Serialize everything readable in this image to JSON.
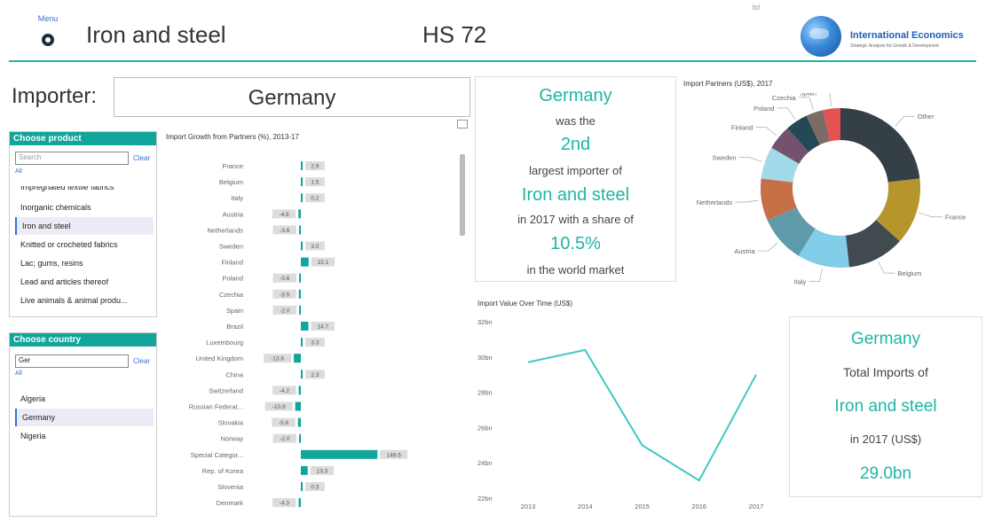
{
  "header": {
    "menu_label": "Menu",
    "title": "Iron and steel",
    "hs_code": "HS 72",
    "tiny_mark": "tcl",
    "logo_title": "International Economics",
    "logo_subtitle": "Strategic Analysis for Growth & Development",
    "accent": "#1fb5a5"
  },
  "importer": {
    "label": "Importer:",
    "value": "Germany"
  },
  "product_slicer": {
    "header": "Choose product",
    "search_placeholder": "Search",
    "clear": "Clear",
    "all": "All",
    "items": [
      "Impregnated textile fabrics",
      "Inorganic chemicals",
      "Iron and steel",
      "Knitted or crocheted fabrics",
      "Lac; gums, resins",
      "Lead and articles thereof",
      "Live animals & animal produ..."
    ],
    "selected": "Iron and steel"
  },
  "country_slicer": {
    "header": "Choose country",
    "search_value": "Ger",
    "clear": "Clear",
    "all": "All",
    "items": [
      "Algeria",
      "Germany",
      "Nigeria"
    ],
    "selected": "Germany"
  },
  "summary_card": {
    "country": "Germany",
    "was_the": "was the",
    "rank": "2nd",
    "largest": "largest importer of",
    "product": "Iron and steel",
    "year_share": "in 2017 with a share of",
    "share": "10.5%",
    "world": "in the world market"
  },
  "total_card": {
    "country": "Germany",
    "total_imports": "Total Imports of",
    "product": "Iron and steel",
    "year": "in 2017 (US$)",
    "value": "29.0bn"
  },
  "chart_data": [
    {
      "type": "bar",
      "orientation": "horizontal",
      "title": "Import Growth from Partners (%), 2013-17",
      "categories": [
        "France",
        "Belgium",
        "Italy",
        "Austria",
        "Netherlands",
        "Sweden",
        "Finland",
        "Poland",
        "Czechia",
        "Spain",
        "Brazil",
        "Luxembourg",
        "United Kingdom",
        "China",
        "Switzerland",
        "Russian Federat...",
        "Slovakia",
        "Norway",
        "Special Categor...",
        "Rep. of Korea",
        "Slovenia",
        "Denmark"
      ],
      "values": [
        2.9,
        1.5,
        0.2,
        -4.8,
        -3.6,
        3.0,
        15.1,
        -0.6,
        -3.9,
        -2.0,
        14.7,
        3.3,
        -13.6,
        2.3,
        -4.2,
        -10.9,
        -5.6,
        -2.0,
        148.6,
        13.3,
        0.3,
        -4.3
      ],
      "labels": [
        "2.9",
        "1.5",
        "0.2",
        "-4.8",
        "-3.6",
        "3.0",
        "15.1",
        "-0.6",
        "-3.9",
        "-2.0",
        "14.7",
        "3.3",
        "-13.6",
        "2.3",
        "-4.2",
        "-10.9",
        "-5.6",
        "-2.0",
        "148.6",
        "13.3",
        "0.3",
        "-4.3"
      ],
      "color": "#11a59b"
    },
    {
      "type": "line",
      "title": "Import Value Over Time (US$)",
      "x": [
        "2013",
        "2014",
        "2015",
        "2016",
        "2017"
      ],
      "values": [
        29.7,
        30.4,
        25.0,
        23.0,
        29.0
      ],
      "yticks": [
        "22bn",
        "24bn",
        "26bn",
        "28bn",
        "30bn",
        "32bn"
      ],
      "ylim": [
        22,
        32
      ],
      "color": "#3ec9c0"
    },
    {
      "type": "pie",
      "donut": true,
      "title": "Import Partners (US$), 2017",
      "labels": [
        "Other",
        "France",
        "Belgium",
        "Italy",
        "Austria",
        "Netherlands",
        "Sweden",
        "Finland",
        "Poland",
        "Czechia",
        "Spain"
      ],
      "values": [
        23.0,
        13.5,
        11.5,
        10.5,
        9.5,
        8.5,
        6.5,
        5.0,
        4.5,
        3.5,
        3.5
      ],
      "colors": [
        "#343f46",
        "#b5952c",
        "#414a4e",
        "#82cde8",
        "#5f9aaa",
        "#c76f47",
        "#a2daea",
        "#74516c",
        "#244856",
        "#7d6b65",
        "#e35151"
      ]
    }
  ]
}
